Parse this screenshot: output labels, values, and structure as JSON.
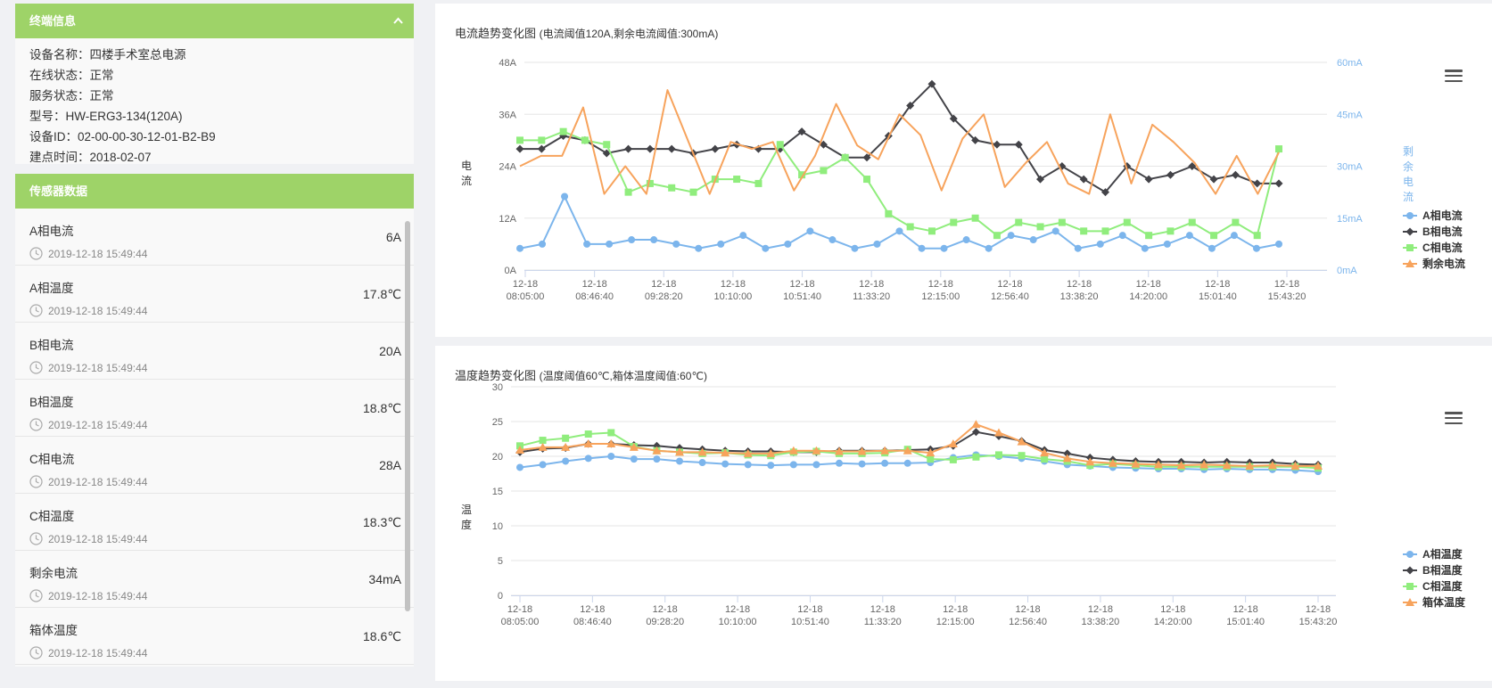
{
  "terminal": {
    "title": "终端信息",
    "rows": [
      "设备名称：四楼手术室总电源",
      "在线状态：正常",
      "服务状态：正常",
      "型号：HW-ERG3-134(120A)",
      "设备ID：02-00-00-30-12-01-B2-B9",
      "建点时间：2018-02-07"
    ]
  },
  "sensors": {
    "title": "传感器数据",
    "items": [
      {
        "name": "A相电流",
        "time": "2019-12-18 15:49:44",
        "value": "6A"
      },
      {
        "name": "A相温度",
        "time": "2019-12-18 15:49:44",
        "value": "17.8℃"
      },
      {
        "name": "B相电流",
        "time": "2019-12-18 15:49:44",
        "value": "20A"
      },
      {
        "name": "B相温度",
        "time": "2019-12-18 15:49:44",
        "value": "18.8℃"
      },
      {
        "name": "C相电流",
        "time": "2019-12-18 15:49:44",
        "value": "28A"
      },
      {
        "name": "C相温度",
        "time": "2019-12-18 15:49:44",
        "value": "18.3℃"
      },
      {
        "name": "剩余电流",
        "time": "2019-12-18 15:49:44",
        "value": "34mA"
      },
      {
        "name": "箱体温度",
        "time": "2019-12-18 15:49:44",
        "value": "18.6℃"
      }
    ]
  },
  "colors": {
    "a": "#7cb5ec",
    "b": "#434348",
    "c": "#90ed7d",
    "d": "#f7a35c",
    "header": "#9ed368"
  },
  "chart_data": [
    {
      "type": "line",
      "title": "电流趋势变化图",
      "subtitle": "(电流阈值120A,剩余电流阈值:300mA)",
      "ylabel": "电流",
      "y2label": "剩余电流",
      "ylim": [
        0,
        48
      ],
      "y2lim": [
        0,
        60
      ],
      "yticks": [
        "0A",
        "12A",
        "24A",
        "36A",
        "48A"
      ],
      "y2ticks": [
        "0mA",
        "15mA",
        "30mA",
        "45mA",
        "60mA"
      ],
      "xticks": [
        [
          "12-18",
          "08:05:00"
        ],
        [
          "12-18",
          "08:46:40"
        ],
        [
          "12-18",
          "09:28:20"
        ],
        [
          "12-18",
          "10:10:00"
        ],
        [
          "12-18",
          "10:51:40"
        ],
        [
          "12-18",
          "11:33:20"
        ],
        [
          "12-18",
          "12:15:00"
        ],
        [
          "12-18",
          "12:56:40"
        ],
        [
          "12-18",
          "13:38:20"
        ],
        [
          "12-18",
          "14:20:00"
        ],
        [
          "12-18",
          "15:01:40"
        ],
        [
          "12-18",
          "15:43:20"
        ]
      ],
      "legend_position": "right",
      "series": [
        {
          "name": "A相电流",
          "color": "#7cb5ec",
          "marker": "circle",
          "axis": "left",
          "values": [
            5,
            6,
            17,
            6,
            6,
            7,
            7,
            6,
            5,
            6,
            8,
            5,
            6,
            9,
            7,
            5,
            6,
            9,
            5,
            5,
            7,
            5,
            8,
            7,
            9,
            5,
            6,
            8,
            5,
            6,
            8,
            5,
            8,
            5,
            6
          ]
        },
        {
          "name": "B相电流",
          "color": "#434348",
          "marker": "diamond",
          "axis": "left",
          "values": [
            28,
            28,
            31,
            30,
            27,
            28,
            28,
            28,
            27,
            28,
            29,
            28,
            28,
            32,
            29,
            26,
            26,
            31,
            38,
            43,
            35,
            30,
            29,
            29,
            21,
            24,
            21,
            18,
            24,
            21,
            22,
            24,
            21,
            22,
            20,
            20
          ]
        },
        {
          "name": "C相电流",
          "color": "#90ed7d",
          "marker": "square",
          "axis": "left",
          "values": [
            30,
            30,
            32,
            30,
            29,
            18,
            20,
            19,
            18,
            21,
            21,
            20,
            29,
            22,
            23,
            26,
            21,
            13,
            10,
            9,
            11,
            12,
            8,
            11,
            10,
            11,
            9,
            9,
            11,
            8,
            9,
            11,
            8,
            11,
            8,
            28
          ]
        },
        {
          "name": "剩余电流",
          "color": "#f7a35c",
          "marker": "triangle",
          "axis": "right",
          "values": [
            30,
            33,
            33,
            47,
            22,
            30,
            22,
            52,
            37,
            22,
            37,
            35,
            37,
            23,
            33,
            48,
            36,
            32,
            45,
            39,
            23,
            38,
            45,
            24,
            31,
            37,
            25,
            22,
            45,
            25,
            42,
            37,
            31,
            22,
            33,
            22,
            34
          ]
        }
      ]
    },
    {
      "type": "line",
      "title": "温度趋势变化图",
      "subtitle": "(温度阈值60℃,箱体温度阈值:60℃)",
      "ylabel": "温度",
      "ylim": [
        0,
        30
      ],
      "yticks": [
        "0",
        "5",
        "10",
        "15",
        "20",
        "25",
        "30"
      ],
      "xticks": [
        [
          "12-18",
          "08:05:00"
        ],
        [
          "12-18",
          "08:46:40"
        ],
        [
          "12-18",
          "09:28:20"
        ],
        [
          "12-18",
          "10:10:00"
        ],
        [
          "12-18",
          "10:51:40"
        ],
        [
          "12-18",
          "11:33:20"
        ],
        [
          "12-18",
          "12:15:00"
        ],
        [
          "12-18",
          "12:56:40"
        ],
        [
          "12-18",
          "13:38:20"
        ],
        [
          "12-18",
          "14:20:00"
        ],
        [
          "12-18",
          "15:01:40"
        ],
        [
          "12-18",
          "15:43:20"
        ]
      ],
      "legend_position": "right",
      "series": [
        {
          "name": "A相温度",
          "color": "#7cb5ec",
          "marker": "circle",
          "values": [
            18.4,
            18.8,
            19.3,
            19.7,
            20.0,
            19.6,
            19.6,
            19.3,
            19.1,
            18.9,
            18.8,
            18.7,
            18.8,
            18.8,
            19.0,
            18.9,
            19.0,
            19.0,
            19.1,
            19.8,
            20.2,
            20.0,
            19.7,
            19.3,
            18.8,
            18.6,
            18.4,
            18.3,
            18.2,
            18.2,
            18.1,
            18.2,
            18.1,
            18.1,
            18.0,
            17.8
          ]
        },
        {
          "name": "B相温度",
          "color": "#434348",
          "marker": "diamond",
          "values": [
            20.6,
            21.1,
            21.2,
            21.8,
            21.8,
            21.6,
            21.5,
            21.2,
            21.0,
            20.8,
            20.7,
            20.7,
            20.6,
            20.6,
            20.8,
            20.8,
            20.8,
            20.9,
            21.0,
            21.5,
            23.5,
            22.9,
            22.2,
            20.9,
            20.4,
            19.8,
            19.5,
            19.3,
            19.2,
            19.2,
            19.1,
            19.2,
            19.1,
            19.1,
            18.9,
            18.8
          ]
        },
        {
          "name": "C相温度",
          "color": "#90ed7d",
          "marker": "square",
          "values": [
            21.5,
            22.3,
            22.6,
            23.2,
            23.4,
            21.4,
            20.8,
            20.6,
            20.4,
            20.5,
            20.2,
            20.1,
            20.6,
            20.7,
            20.4,
            20.4,
            20.5,
            21.0,
            19.6,
            19.5,
            19.9,
            20.2,
            20.1,
            19.6,
            19.3,
            18.7,
            18.9,
            18.7,
            18.5,
            18.5,
            18.5,
            18.5,
            18.5,
            18.5,
            18.5,
            18.3
          ]
        },
        {
          "name": "箱体温度",
          "color": "#f7a35c",
          "marker": "triangle",
          "values": [
            20.9,
            21.3,
            21.3,
            21.8,
            21.8,
            21.3,
            20.8,
            20.6,
            20.6,
            20.5,
            20.4,
            20.4,
            20.8,
            20.8,
            20.7,
            20.7,
            20.8,
            20.8,
            20.5,
            21.8,
            24.6,
            23.4,
            22.1,
            20.5,
            19.7,
            19.2,
            19.0,
            18.9,
            18.8,
            18.7,
            18.8,
            18.7,
            18.6,
            18.7,
            18.6,
            18.6
          ]
        }
      ]
    }
  ]
}
